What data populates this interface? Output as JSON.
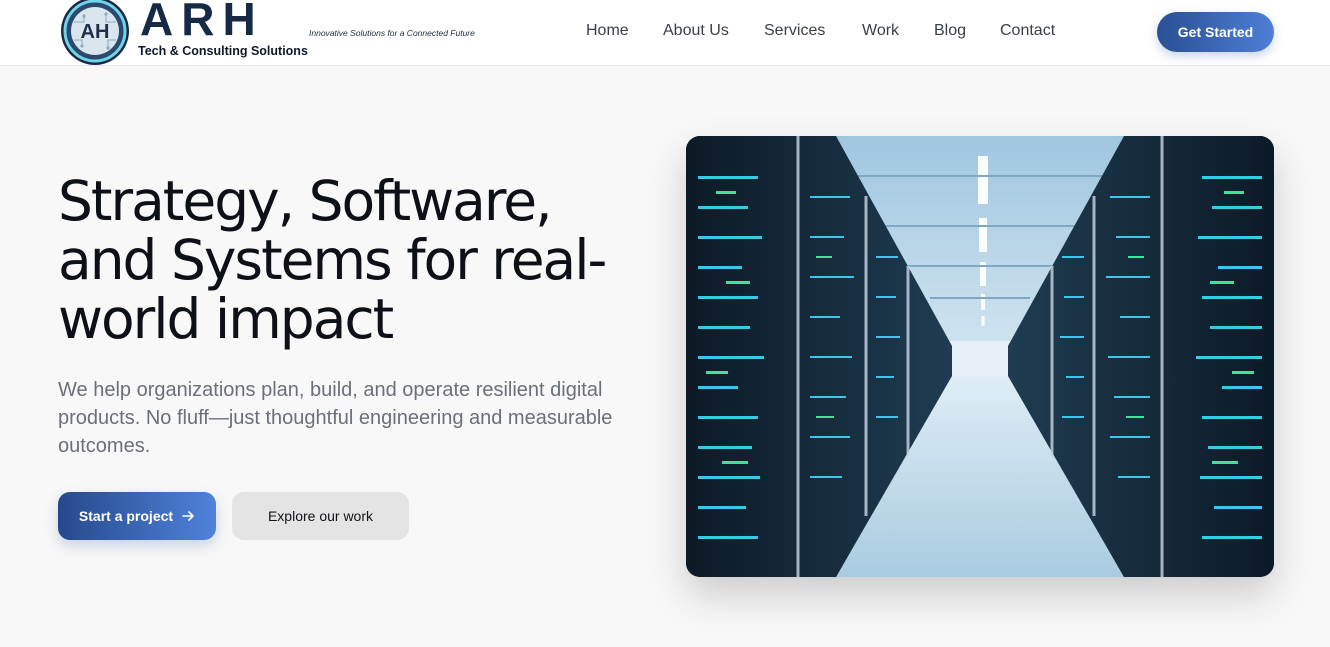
{
  "brand": {
    "name": "ARH",
    "badge_letters": "AH",
    "tagline": "Innovative Solutions for a Connected Future",
    "subtitle": "Tech & Consulting Solutions"
  },
  "nav": {
    "items": [
      "Home",
      "About Us",
      "Services",
      "Work",
      "Blog",
      "Contact"
    ],
    "cta": "Get Started"
  },
  "hero": {
    "title_lines": [
      "Strategy, Software,",
      "and Systems for real-",
      "world impact"
    ],
    "description": "We help organizations plan, build, and operate resilient digital products. No fluff—just thoughtful engineering and measurable outcomes.",
    "primary_button": "Start a project",
    "primary_button_icon": "arrow-right-icon",
    "secondary_button": "Explore our work",
    "image_subject": "server-room-corridor"
  },
  "colors": {
    "brand_dark": "#162a45",
    "accent_start": "#26498c",
    "accent_end": "#4f82db",
    "text_muted": "#6b7078",
    "background": "#f8f8f8"
  }
}
